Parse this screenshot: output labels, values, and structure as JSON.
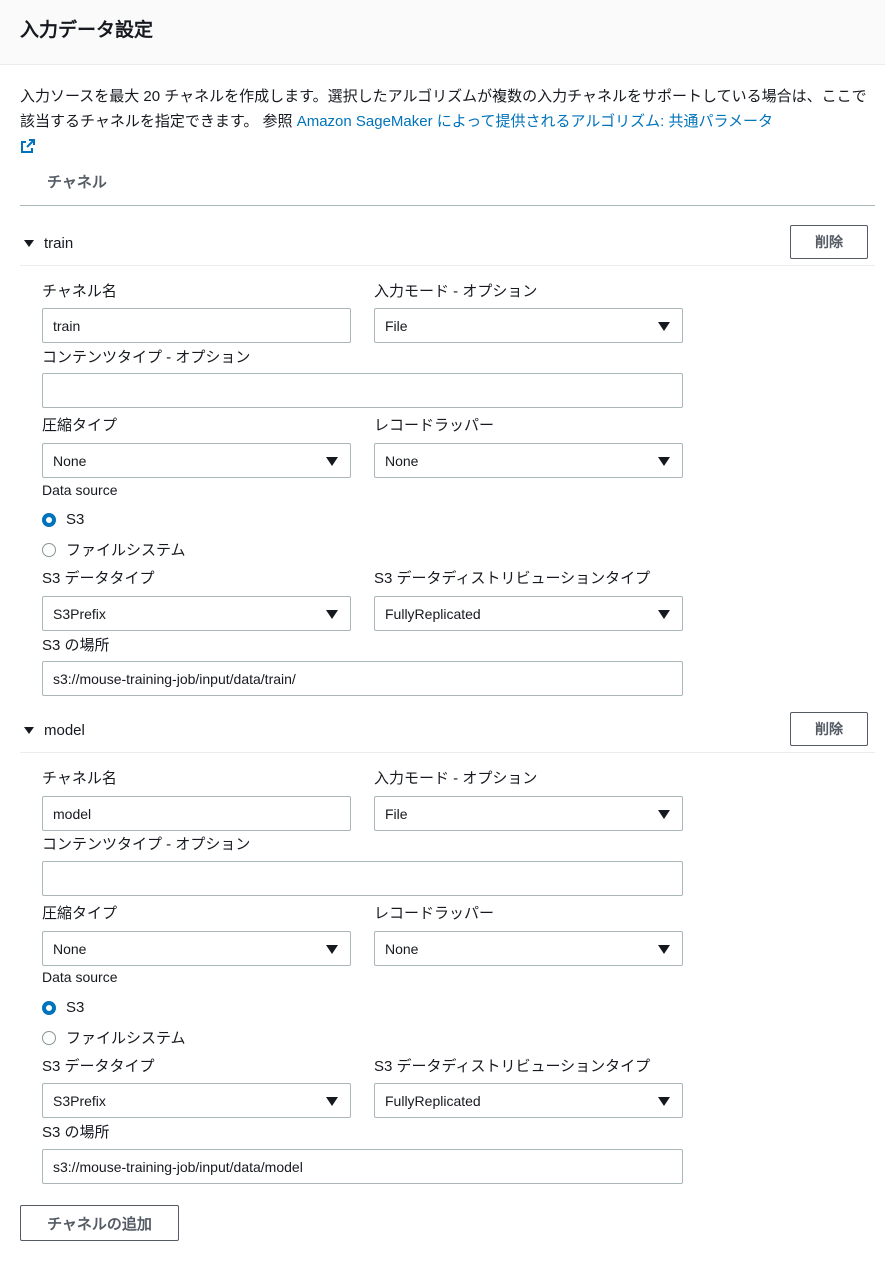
{
  "header": {
    "title": "入力データ設定"
  },
  "description": {
    "text": "入力ソースを最大 20 チャネルを作成します。選択したアルゴリズムが複数の入力チャネルをサポートしている場合は、ここで該当するチャネルを指定できます。 参照 ",
    "link_text": "Amazon SageMaker によって提供されるアルゴリズム: 共通パラメータ",
    "link_icon": "external-link-icon"
  },
  "channels_heading": "チャネル",
  "labels": {
    "channel_name": "チャネル名",
    "input_mode": "入力モード - オプション",
    "content_type": "コンテンツタイプ - オプション",
    "compression_type": "圧縮タイプ",
    "record_wrapper": "レコードラッパー",
    "data_source": "Data source",
    "s3_data_type": "S3 データタイプ",
    "s3_distribution_type": "S3 データディストリビューションタイプ",
    "s3_location": "S3 の場所"
  },
  "delete_label": "削除",
  "radio_options": {
    "s3": "S3",
    "fs": "ファイルシステム"
  },
  "channels": [
    {
      "title": "train",
      "channel_name": "train",
      "input_mode": "File",
      "content_type": "",
      "compression_type": "None",
      "record_wrapper": "None",
      "data_source_selected": "S3",
      "s3_data_type": "S3Prefix",
      "s3_distribution_type": "FullyReplicated",
      "s3_location": "s3://mouse-training-job/input/data/train/"
    },
    {
      "title": "model",
      "channel_name": "model",
      "input_mode": "File",
      "content_type": "",
      "compression_type": "None",
      "record_wrapper": "None",
      "data_source_selected": "S3",
      "s3_data_type": "S3Prefix",
      "s3_distribution_type": "FullyReplicated",
      "s3_location": "s3://mouse-training-job/input/data/model"
    }
  ],
  "add_channel_label": "チャネルの追加",
  "colors": {
    "link": "#0073bb",
    "radio_selected": "#0073bb",
    "text": "#16191f",
    "button_text": "#545b64"
  }
}
